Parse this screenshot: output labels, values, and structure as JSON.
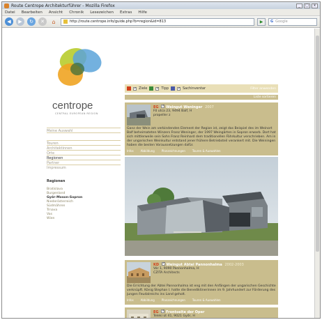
{
  "window": {
    "title": "Route Centrope Architekturführer - Mozilla Firefox",
    "buttons": [
      "_",
      "□",
      "x"
    ]
  },
  "menubar": [
    "Datei",
    "Bearbeiten",
    "Ansicht",
    "Chronik",
    "Lesezeichen",
    "Extras",
    "Hilfe"
  ],
  "navbar": {
    "url": "http://route.centrope.info/guide.php?b=region&id=813",
    "search_placeholder": "Google",
    "search_brand": "G"
  },
  "logo": {
    "word": "centrope",
    "tagline": "CENTRAL EUROPEAN REGION"
  },
  "mainnav": {
    "items": [
      "Meine Auswahl",
      "Touren",
      "Architektinnen",
      "Orte",
      "Regionen",
      "Partner",
      "Impressum"
    ],
    "active": "Regionen"
  },
  "regions": {
    "heading": "Regionen",
    "items": [
      "Bratislava",
      "Burgenland",
      "Győr-Moson-Sopron",
      "Niederösterreich",
      "Südmähren",
      "Trnava",
      "Vas",
      "Wien"
    ],
    "selected": "Győr-Moson-Sopron"
  },
  "filter": {
    "items": [
      {
        "label": "Ziele",
        "color": "#d2401b"
      },
      {
        "label": "Tipp",
        "color": "#3a8b3a"
      },
      {
        "label": "Sachinventar",
        "color": "#4a5aa8"
      }
    ],
    "right_label": "Filter anwenden"
  },
  "sortbar": {
    "label": "Liste sortieren"
  },
  "entries": [
    {
      "num": "EG",
      "title": "Weingut Weninger",
      "year": "2007",
      "address": "Fő utca 23, 9494 Balf, H",
      "architect": "propeller z",
      "body": "Ganz der Wein am verbindenden Element der Region ist, zeigt das Beispiel des im Weinort Balf beheimateten Winzers Franz Weninger, der 1997 Weingärten in Sopron erwarb. Dort hat sich mittlerweile sein Sohn Franz Reinhard dem traditionellen Fährkultur verschrieben. Am in der ungarischen Weinkultur entstand jener frühere Betriebsteil verankert mit. Die Weiningen haben die besten Voraussetzungen dafür.",
      "links": [
        "Infos",
        "Abbildung",
        "Planzeichnungen",
        "Touren & Auswahlen"
      ]
    },
    {
      "num": "KD",
      "title": "Weingut Abtei Pannonhalma",
      "year": "2002-2003",
      "address": "Vár 1, 9090 Pannonhalma, H",
      "architect": "CZITA Architects",
      "body": "Die Errichtung der Abtei Pannonhalma ist eng mit den Anfängen der ungarischen Geschichte verknüpft. König Stephan I. hatte die Benediktinerinnen im 9. Jahrhundert zur Förderung des jungen Feudalreichs ins Land geholt.",
      "links": [
        "Infos",
        "Abbildung",
        "Planzeichnungen",
        "Touren & Auswahlen"
      ]
    },
    {
      "num": "EG",
      "title": "Frontseite der Oper",
      "year": "",
      "address": "Teleki út 41, 9021 Győr, H",
      "architect": "",
      "body": "",
      "links": []
    }
  ],
  "colors": {
    "tan": "#c9bd8d",
    "lighttan": "#e9dfb7",
    "accent_red": "#d2401b"
  }
}
